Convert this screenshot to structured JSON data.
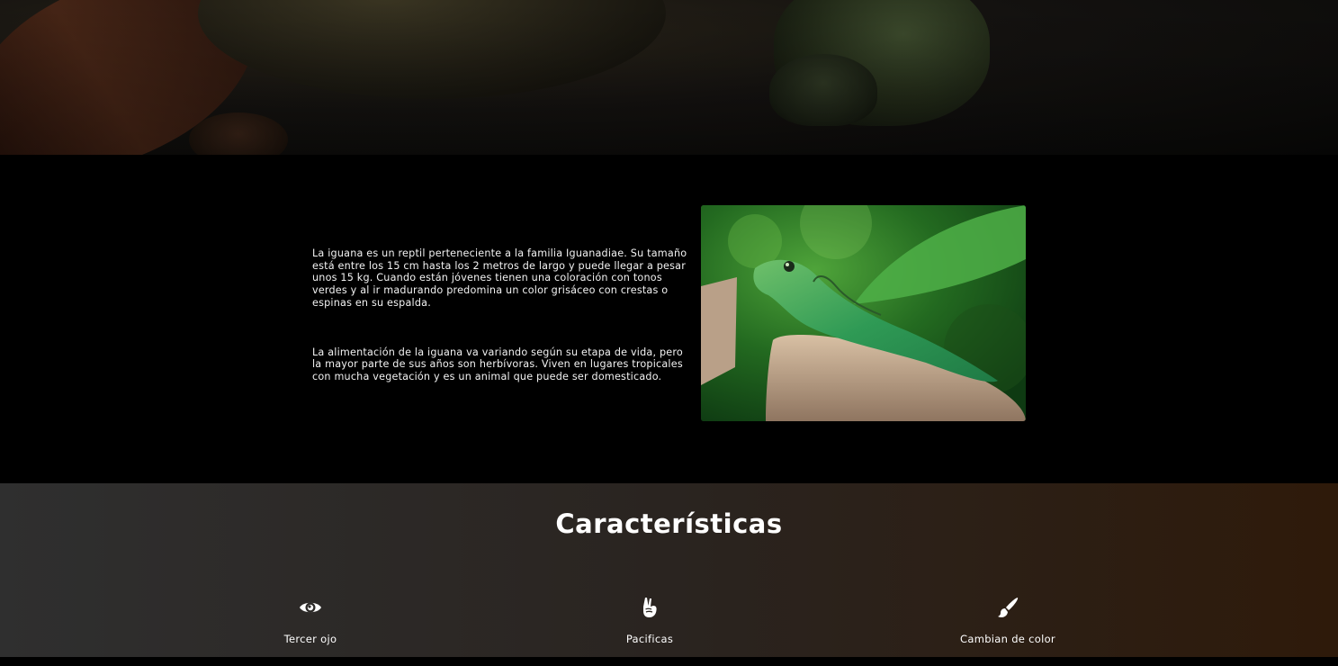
{
  "intro": {
    "paragraph_1": "La iguana es un reptil perteneciente a la familia Iguanadiae. Su tamaño está entre los 15 cm hasta los 2 metros de largo y puede llegar a pesar unos 15 kg. Cuando están jóvenes tienen una coloración con tonos verdes y al ir madurando predomina un color grisáceo con crestas o espinas en su espalda.",
    "paragraph_2": "La alimentación de la iguana va variando según su etapa de vida, pero la mayor parte de sus años son herbívoras. Viven en lugares tropicales con mucha vegetación y es un animal que puede ser domesticado."
  },
  "features": {
    "title": "Características",
    "items": [
      {
        "label": "Tercer ojo",
        "icon": "eye-icon"
      },
      {
        "label": "Pacificas",
        "icon": "peace-hand-icon"
      },
      {
        "label": "Cambian de color",
        "icon": "paint-brush-icon"
      }
    ]
  },
  "colors": {
    "page_background": "#000000",
    "text": "#f2f2f2",
    "features_gradient_start": "#2f2f2f",
    "features_gradient_end": "#2e1a0a"
  }
}
